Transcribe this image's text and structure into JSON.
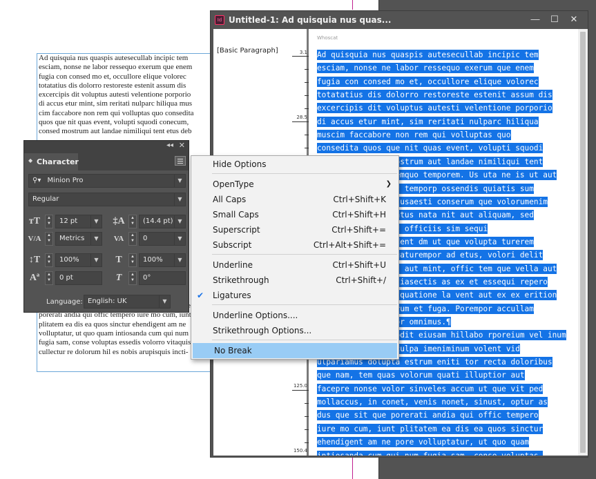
{
  "background_document": {
    "lines": [
      "Ad quisquia nus quaspis autesecullab incipic tem",
      "esciam, nonse ne labor ressequo exerum que enem",
      "fugia con consed mo et, occullore elique volorec",
      "totatatius dis dolorro restoreste estenit assum dis",
      "excercipis dit voluptus autesti velentione porporio",
      "di accus etur mint, sim reritati nulparc hiliqua mus",
      "cim faccabore non rem qui volluptas quo consedita",
      "quos que nit quas event, volupti squodi conecum,",
      "consed mostrum aut landae nimiliqui tent etus deb",
      "",
      "",
      "",
      "",
      "",
      "",
      "",
      "",
      "",
      "",
      "",
      "",
      "",
      "",
      "",
      "",
      "",
      "",
      "conet, venis nonet, sinust, optur as dus que sit que",
      "poreratі andia qui offic tempero iure mo cum, iunt",
      "plitatem ea dis ea quos sinctur ehendigent am ne",
      "volluptatur, ut quo quam intiosanda cum qui num",
      "fugia sam, conse voluptas essedis volorro vitaquis",
      "cullectur re dolorum hil es nobis arupisquis incti-"
    ]
  },
  "story_editor": {
    "title": "Untitled-1: Ad quisquia nus quas...",
    "app_icon": "Id",
    "controls": {
      "minimize": "—",
      "maximize": "☐",
      "close": "✕"
    },
    "top_label": "Whoscat",
    "paragraph_style": "[Basic Paragraph]",
    "ruler_marks": [
      "3.1",
      "28.5",
      "125.0",
      "150.4"
    ],
    "lines": [
      "Ad quisquia nus quaspis autesecullab incipic tem",
      "esciam, nonse ne labor ressequo exerum que enem",
      "fugia con consed mo et, occullore elique volorec",
      "totatatius dis dolorro restoreste estenit assum dis",
      "excercipis dit voluptus autesti velentione porporio",
      "di accus etur mint, sim reritati nulparc hiliqua",
      "muscim faccabore non rem qui volluptas quo",
      "consedita quos que nit quas event, volupti squodi",
      "conecum, consed mostrum aut landae nimiliqui tent",
      "etus debit aut utemquo temporem. Us uta ne is ut aut",
      "lautatur, nimolest temporp ossendis quiatis sum",
      "laborerum, nobis susaesti conserum que volorumenim",
      "quistiae dolupiciatus nata nit aut aliquam, sed",
      "quasperit occus et officiis sim sequi",
      "niminveliquo tem dent dm ut que volupta turerem",
      "harum rem corem quaturempor ad etus, volori delit",
      "aut anis con earis aut mint, offic tem que vella aut",
      "fuga. Et odist estiasectis as ex et essequi repero",
      "enditiorem id eos quatione la vent aut ex ex erition",
      "nimusandae nus earum et fuga. Porempor accullam",
      "velit la quae volor omnimus.¶",
      "Ut aut eatur? Temodit eiusam hillabo rporeium vel inum",
      "quiberorem ex et culpa imeniminum volent vid",
      "ulpariamus dolupta estrum eniti tor recta doloribus",
      "que nam, tem quas volorum quati illuptior aut",
      "facepre nonse volor sinveles accum ut que vit ped",
      "mollaccus, in conet, venis nonet, sinust, optur as",
      "dus que sit que porerati andia qui offic tempero",
      "iure mo cum, iunt plitatem ea dis ea quos sinctur",
      "ehendigent am ne pore volluptatur, ut quo quam",
      "intiosanda cum qui num fugia sam, conse voluptas."
    ]
  },
  "character_panel": {
    "title": "Character",
    "collapse_glyph": "◂◂",
    "close_glyph": "✕",
    "font_family": "Minion Pro",
    "font_style": "Regular",
    "font_size": "12 pt",
    "leading": "(14.4 pt)",
    "kerning": "Metrics",
    "tracking": "0",
    "vertical_scale": "100%",
    "horizontal_scale": "100%",
    "baseline_shift": "0 pt",
    "skew": "0°",
    "language_label": "Language:",
    "language": "English: UK"
  },
  "context_menu": {
    "items": [
      {
        "label": "Hide Options",
        "shortcut": ""
      },
      {
        "label": "OpenType",
        "shortcut": "",
        "submenu": true
      },
      {
        "label": "All Caps",
        "shortcut": "Ctrl+Shift+K"
      },
      {
        "label": "Small Caps",
        "shortcut": "Ctrl+Shift+H"
      },
      {
        "label": "Superscript",
        "shortcut": "Ctrl+Shift+="
      },
      {
        "label": "Subscript",
        "shortcut": "Ctrl+Alt+Shift+="
      },
      {
        "label": "Underline",
        "shortcut": "Ctrl+Shift+U"
      },
      {
        "label": "Strikethrough",
        "shortcut": "Ctrl+Shift+/"
      },
      {
        "label": "Ligatures",
        "shortcut": "",
        "checked": true
      },
      {
        "label": "Underline Options....",
        "shortcut": ""
      },
      {
        "label": "Strikethrough Options...",
        "shortcut": ""
      },
      {
        "label": "No Break",
        "shortcut": "",
        "highlighted": true
      }
    ]
  },
  "colors": {
    "selection": "#1473e6",
    "menu_highlight": "#99ccf5",
    "panel_bg": "#535353",
    "pasteboard": "#535353"
  }
}
